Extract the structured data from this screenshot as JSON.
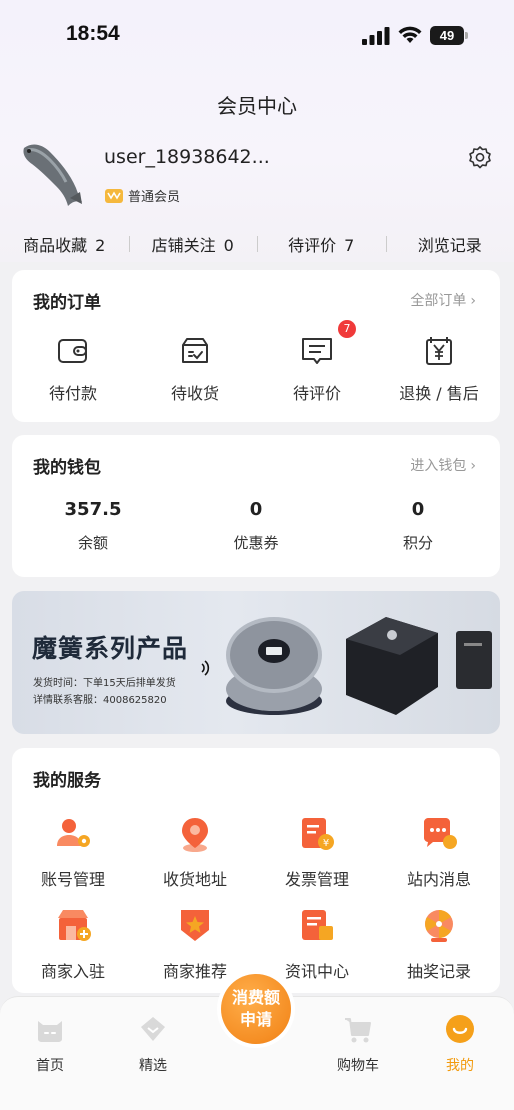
{
  "status_bar": {
    "time": "18:54",
    "battery": "49"
  },
  "header": {
    "title": "会员中心"
  },
  "profile": {
    "username": "user_18938642...",
    "member_level": "普通会员"
  },
  "stats": [
    {
      "label": "商品收藏",
      "value": "2"
    },
    {
      "label": "店铺关注",
      "value": "0"
    },
    {
      "label": "待评价",
      "value": "7"
    },
    {
      "label": "浏览记录",
      "value": ""
    }
  ],
  "orders": {
    "title": "我的订单",
    "link": "全部订单",
    "items": [
      {
        "label": "待付款",
        "icon": "wallet-icon"
      },
      {
        "label": "待收货",
        "icon": "package-icon"
      },
      {
        "label": "待评价",
        "icon": "comment-icon",
        "badge": "7"
      },
      {
        "label": "退换 / 售后",
        "icon": "refund-icon"
      }
    ]
  },
  "wallet": {
    "title": "我的钱包",
    "link": "进入钱包",
    "items": [
      {
        "value": "357.5",
        "label": "余额"
      },
      {
        "value": "0",
        "label": "优惠券"
      },
      {
        "value": "0",
        "label": "积分"
      }
    ]
  },
  "banner": {
    "title": "魔簧系列产品",
    "line1": "发货时间：下单15天后排单发货",
    "line2": "详情联系客服：4008625820"
  },
  "services": {
    "title": "我的服务",
    "items": [
      {
        "label": "账号管理",
        "icon": "account-settings-icon"
      },
      {
        "label": "收货地址",
        "icon": "location-pin-icon"
      },
      {
        "label": "发票管理",
        "icon": "invoice-icon"
      },
      {
        "label": "站内消息",
        "icon": "message-icon"
      },
      {
        "label": "商家入驻",
        "icon": "store-join-icon"
      },
      {
        "label": "商家推荐",
        "icon": "recommend-badge-icon"
      },
      {
        "label": "资讯中心",
        "icon": "news-icon"
      },
      {
        "label": "抽奖记录",
        "icon": "lottery-icon"
      }
    ]
  },
  "tabbar": {
    "items": [
      {
        "label": "首页",
        "icon": "home-cat-icon"
      },
      {
        "label": "精选",
        "icon": "featured-icon"
      },
      {
        "label": "购物车",
        "icon": "cart-icon"
      },
      {
        "label": "我的",
        "icon": "profile-icon",
        "active": true
      }
    ],
    "center": {
      "line1": "消费额",
      "line2": "申请"
    }
  },
  "colors": {
    "accent": "#f29a0c",
    "badge_red": "#f03a3a",
    "fab_orange": "#f58e24",
    "service_icon": "#f4623a"
  }
}
